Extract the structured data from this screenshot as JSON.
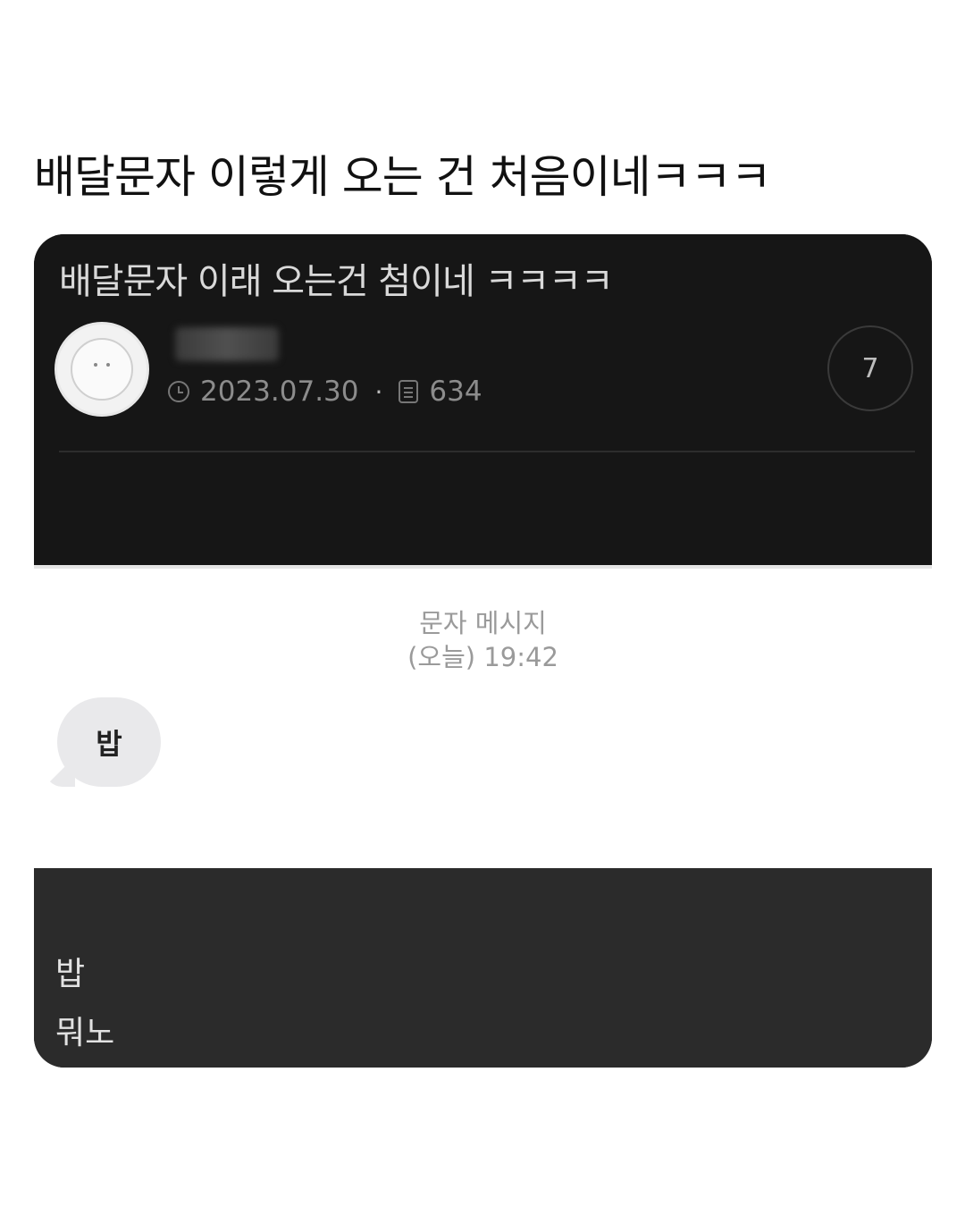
{
  "headline": "배달문자 이렇게 오는 건 처음이네ㅋㅋㅋ",
  "post": {
    "title": "배달문자 이래 오는건 첨이네 ㅋㅋㅋㅋ",
    "date": "2023.07.30",
    "views": "634",
    "comment_count": "7",
    "separator": "·"
  },
  "sms": {
    "label": "문자 메시지",
    "time": "(오늘) 19:42",
    "bubble_text": "밥"
  },
  "body": {
    "lines": [
      "밥",
      "뭐노"
    ]
  },
  "colors": {
    "card_dark": "#161616",
    "card_bottom": "#2b2b2b",
    "bubble": "#e9e9eb"
  }
}
